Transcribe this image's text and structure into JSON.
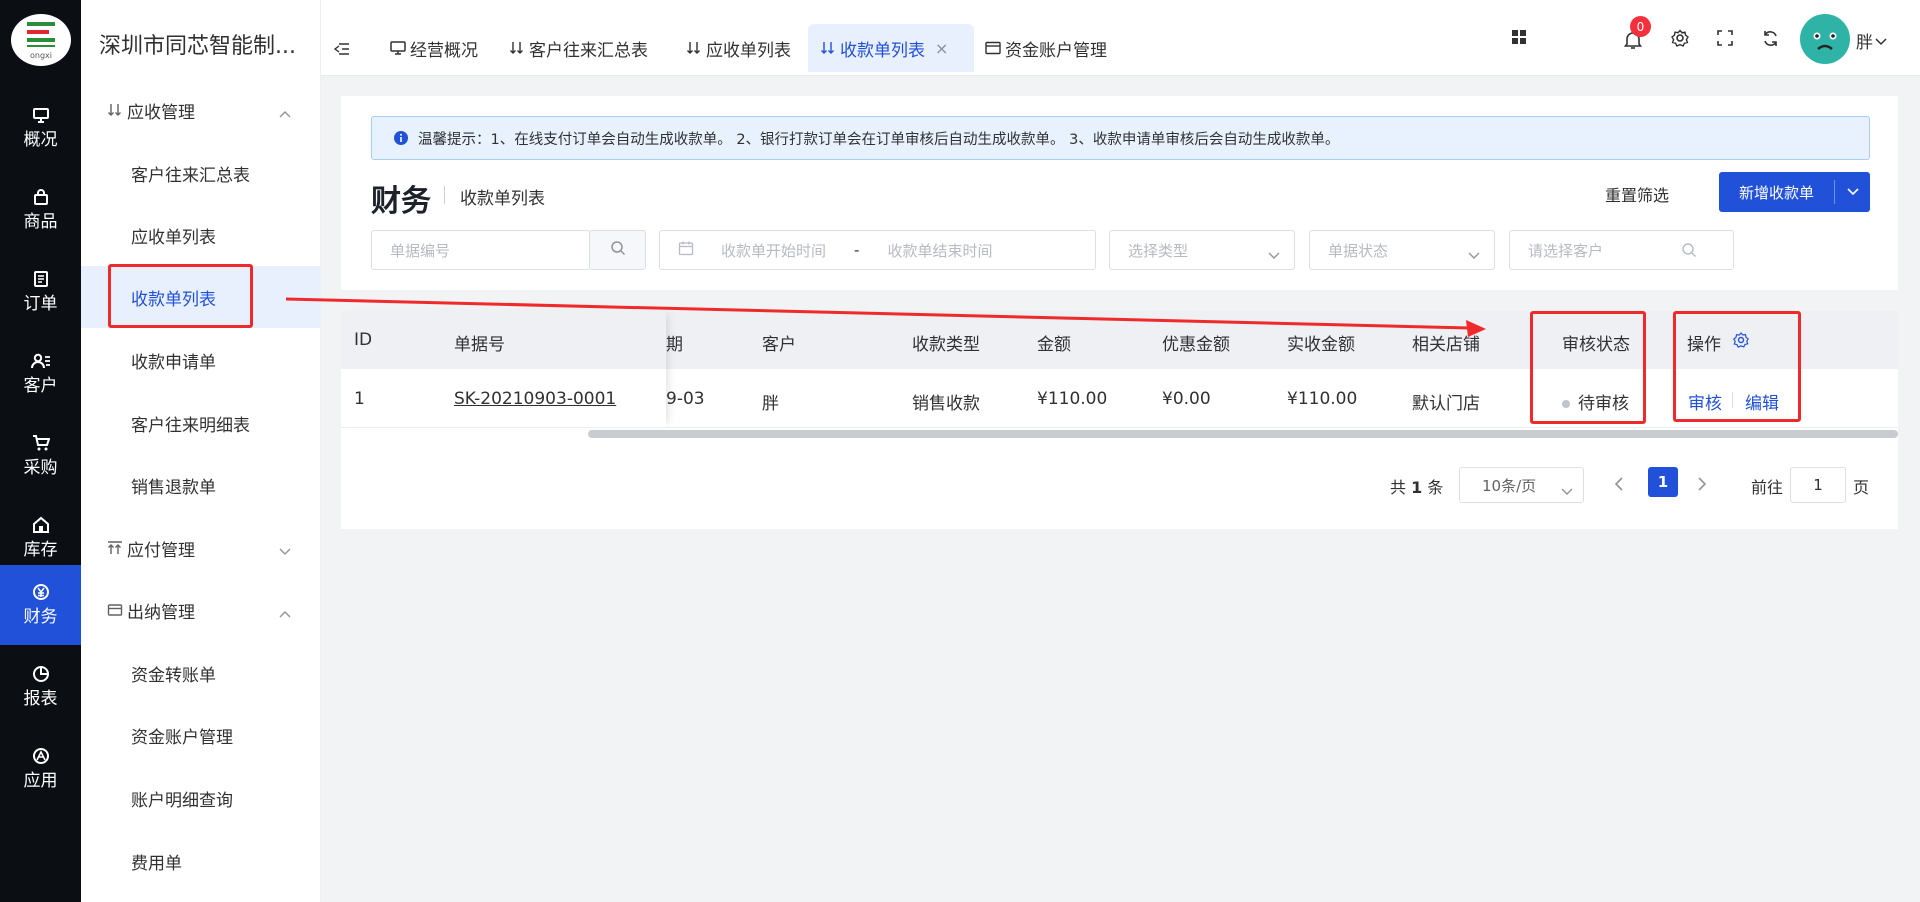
{
  "nav": {
    "logo_text": "ongxi",
    "items": [
      {
        "label": "概况",
        "icon": "monitor-icon"
      },
      {
        "label": "商品",
        "icon": "bag-icon"
      },
      {
        "label": "订单",
        "icon": "document-icon"
      },
      {
        "label": "客户",
        "icon": "user-list-icon"
      },
      {
        "label": "采购",
        "icon": "cart-icon"
      },
      {
        "label": "库存",
        "icon": "warehouse-icon"
      },
      {
        "label": "财务",
        "icon": "yen-icon",
        "active": true
      },
      {
        "label": "报表",
        "icon": "pie-chart-icon"
      },
      {
        "label": "应用",
        "icon": "apps-icon"
      }
    ]
  },
  "sidebar": {
    "company": "深圳市同芯智能制...",
    "groups": [
      {
        "label": "应收管理",
        "expanded": true,
        "items": [
          "客户往来汇总表",
          "应收单列表",
          "收款单列表",
          "收款申请单",
          "客户往来明细表",
          "销售退款单"
        ]
      },
      {
        "label": "应付管理",
        "expanded": false,
        "items": []
      },
      {
        "label": "出纳管理",
        "expanded": true,
        "items": [
          "资金转账单",
          "资金账户管理",
          "账户明细查询",
          "费用单"
        ]
      }
    ],
    "active_item": "收款单列表"
  },
  "tabs": [
    {
      "label": "经营概况"
    },
    {
      "label": "客户往来汇总表"
    },
    {
      "label": "应收单列表"
    },
    {
      "label": "收款单列表",
      "active": true,
      "closable": "×"
    },
    {
      "label": "资金账户管理"
    }
  ],
  "header_right": {
    "notification_count": "0",
    "user_name": "胖"
  },
  "tip": "温馨提示：1、在线支付订单会自动生成收款单。 2、银行打款订单会在订单审核后自动生成收款单。 3、收款申请单审核后会自动生成收款单。",
  "page": {
    "title": "财务",
    "subtitle": "收款单列表",
    "reset_label": "重置筛选",
    "add_label": "新增收款单"
  },
  "filters": {
    "doc_no_placeholder": "单据编号",
    "start_placeholder": "收款单开始时间",
    "range_sep": "-",
    "end_placeholder": "收款单结束时间",
    "type_placeholder": "选择类型",
    "status_placeholder": "单据状态",
    "customer_placeholder": "请选择客户"
  },
  "table": {
    "columns": [
      "ID",
      "单据号",
      "期",
      "客户",
      "收款类型",
      "金额",
      "优惠金额",
      "实收金额",
      "相关店铺",
      "审核状态",
      "操作"
    ],
    "rows": [
      {
        "id": "1",
        "doc_no": "SK-20210903-0001",
        "date": "9-03",
        "customer": "胖",
        "type": "销售收款",
        "amount": "¥110.00",
        "discount": "¥0.00",
        "received": "¥110.00",
        "store": "默认门店",
        "status": "待审核",
        "actions": [
          "审核",
          "编辑"
        ]
      }
    ]
  },
  "pagination": {
    "total_prefix": "共",
    "total_count": "1",
    "total_suffix": "条",
    "page_size": "10条/页",
    "current_page": "1",
    "goto_label": "前往",
    "goto_value": "1",
    "page_suffix": "页"
  },
  "colors": {
    "primary": "#2151d8",
    "nav_bg": "#0b0f14",
    "annotation_red": "#f02a2a",
    "badge_red": "#f5313d"
  }
}
